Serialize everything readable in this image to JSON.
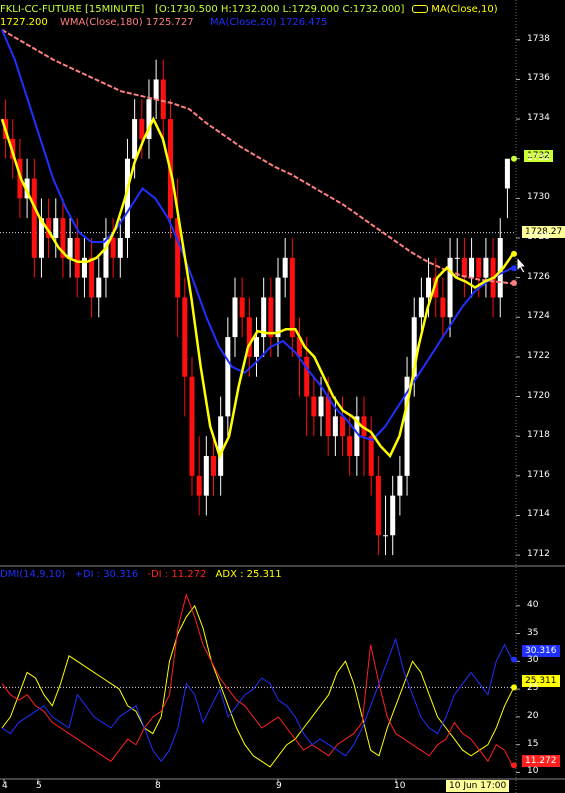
{
  "header": {
    "symbol": "FKLI-CC-FUTURE [15MINUTE]",
    "ohlc": "[O:1730.500 H:1732.000 L:1729.000 C:1732.000]",
    "ma10": "MA(Close,10)",
    "ma10_value": "1727.200",
    "wma180": "WMA(Close,180)",
    "wma180_value": "1725.727",
    "ma20": "MA(Close,20)",
    "ma20_value": "1726.475"
  },
  "dmi_header": {
    "label": "DMI(14,9,10)",
    "pdi": "+DI : 30.316",
    "mdi": "-DI : 11.272",
    "adx": "ADX : 25.311"
  },
  "tags": {
    "last_price": "1732",
    "cursor_price": "1728.27",
    "pdi_value": "30.316",
    "adx_value": "25.311",
    "mdi_value": "11.272",
    "cursor_time": "10 Jun 17:00"
  },
  "colors": {
    "ma10": "#ffff00",
    "wma180": "#ff8080",
    "ma20": "#2030ff",
    "pdi": "#2030ff",
    "mdi": "#ff2020",
    "adx": "#ffff00",
    "bull": "#ffffff",
    "bear": "#ff1010",
    "header_green": "#ccff33"
  },
  "chart_data": [
    {
      "type": "candlestick",
      "title": "FKLI-CC-FUTURE [15MINUTE]",
      "ylim": [
        1711.5,
        1739
      ],
      "yticks": [
        1712,
        1714,
        1716,
        1718,
        1720,
        1722,
        1724,
        1726,
        1728,
        1730,
        1732,
        1734,
        1736,
        1738
      ],
      "close": [
        1733,
        1732,
        1730,
        1731,
        1727,
        1729,
        1728,
        1729,
        1727,
        1728,
        1726,
        1727,
        1725,
        1726,
        1728,
        1727,
        1728,
        1732,
        1734,
        1733,
        1735,
        1736,
        1734,
        1729,
        1725,
        1721,
        1716,
        1715,
        1717,
        1716,
        1719,
        1723,
        1725,
        1724,
        1722,
        1723,
        1725,
        1723,
        1726,
        1727,
        1723,
        1722,
        1720,
        1719,
        1720,
        1718,
        1719,
        1718,
        1717,
        1719,
        1718,
        1716,
        1713,
        1713,
        1715,
        1716,
        1721,
        1724,
        1725,
        1726,
        1725,
        1724,
        1727,
        1727,
        1726,
        1727,
        1726,
        1727,
        1725,
        1728,
        1732
      ],
      "open": [
        1734,
        1733,
        1732,
        1730,
        1731,
        1727,
        1729,
        1728,
        1729,
        1727,
        1728,
        1726,
        1727,
        1725,
        1726,
        1728,
        1727,
        1728,
        1732,
        1734,
        1733,
        1735,
        1736,
        1734,
        1729,
        1725,
        1721,
        1716,
        1715,
        1717,
        1716,
        1719,
        1723,
        1725,
        1724,
        1722,
        1723,
        1725,
        1723,
        1726,
        1727,
        1723,
        1722,
        1720,
        1719,
        1720,
        1718,
        1719,
        1718,
        1717,
        1719,
        1718,
        1716,
        1713,
        1713,
        1715,
        1716,
        1721,
        1724,
        1725,
        1726,
        1725,
        1724,
        1727,
        1727,
        1726,
        1727,
        1726,
        1727,
        1725,
        1730.5
      ],
      "high": [
        1735,
        1734,
        1733,
        1732,
        1732,
        1730,
        1730,
        1730,
        1730,
        1729,
        1729,
        1728,
        1728,
        1727,
        1729,
        1729,
        1729,
        1733,
        1735,
        1735,
        1736,
        1737,
        1737,
        1735,
        1731,
        1726,
        1722,
        1718,
        1718,
        1718,
        1720,
        1724,
        1726,
        1726,
        1725,
        1724,
        1726,
        1726,
        1727,
        1728,
        1728,
        1724,
        1723,
        1721,
        1721,
        1721,
        1720,
        1720,
        1719,
        1720,
        1720,
        1719,
        1717,
        1715,
        1716,
        1717,
        1722,
        1725,
        1726,
        1727,
        1727,
        1726,
        1728,
        1728,
        1728,
        1728,
        1727,
        1728,
        1728,
        1729,
        1732
      ],
      "low": [
        1732,
        1731,
        1729,
        1729,
        1726,
        1726,
        1727,
        1727,
        1726,
        1726,
        1725,
        1725,
        1724,
        1724,
        1725,
        1726,
        1726,
        1727,
        1731,
        1732,
        1732,
        1734,
        1733,
        1728,
        1723,
        1719,
        1715,
        1714,
        1714,
        1715,
        1715,
        1718,
        1722,
        1723,
        1721,
        1721,
        1722,
        1722,
        1722,
        1725,
        1722,
        1720,
        1718,
        1718,
        1718,
        1717,
        1717,
        1717,
        1716,
        1716,
        1716,
        1715,
        1712,
        1712,
        1712,
        1714,
        1715,
        1720,
        1723,
        1724,
        1724,
        1723,
        1723,
        1726,
        1725,
        1725,
        1725,
        1725,
        1724,
        1724,
        1729
      ],
      "series": [
        {
          "name": "MA(Close,10)",
          "values": [
            1734,
            1732.5,
            1731,
            1730,
            1729,
            1728.3,
            1727.5,
            1727,
            1726.8,
            1726.8,
            1727,
            1727.5,
            1728.5,
            1730,
            1731.8,
            1733,
            1734,
            1733,
            1731,
            1728,
            1725,
            1721.5,
            1718.5,
            1717,
            1718,
            1720.5,
            1722.5,
            1723.3,
            1723.2,
            1723.2,
            1723.4,
            1723.4,
            1722.5,
            1722,
            1721,
            1720,
            1719.3,
            1719,
            1718.5,
            1718.2,
            1717.5,
            1717,
            1718,
            1720,
            1722.5,
            1724.5,
            1726,
            1726.5,
            1726,
            1725.8,
            1725.5,
            1725.8,
            1726,
            1726.5,
            1727.2
          ]
        },
        {
          "name": "WMA(Close,180)",
          "values": [
            1738.5,
            1738,
            1737.5,
            1737,
            1736.6,
            1736.2,
            1735.8,
            1735.4,
            1735.2,
            1735,
            1734.8,
            1734.5,
            1733.8,
            1733.2,
            1732.6,
            1732.1,
            1731.6,
            1731.2,
            1730.7,
            1730.2,
            1729.7,
            1729.1,
            1728.5,
            1727.9,
            1727.3,
            1726.8,
            1726.4,
            1726.1,
            1725.9,
            1725.8,
            1725.7
          ]
        },
        {
          "name": "MA(Close,20)",
          "values": [
            1738.5,
            1737,
            1735,
            1733,
            1731,
            1729.5,
            1728.3,
            1727.8,
            1727.8,
            1728.5,
            1729.5,
            1730.5,
            1730,
            1729,
            1727.5,
            1725.8,
            1724,
            1722.5,
            1721.5,
            1721.2,
            1721.8,
            1722.5,
            1722.8,
            1722.2,
            1721.3,
            1720.5,
            1719.5,
            1718.8,
            1718,
            1717.8,
            1718.5,
            1719.5,
            1720.5,
            1721.5,
            1722.5,
            1723.5,
            1724.5,
            1725.3,
            1725.8,
            1726.2,
            1726.5
          ]
        }
      ]
    },
    {
      "type": "line",
      "title": "DMI(14,9,10)",
      "ylim": [
        9,
        45
      ],
      "yticks": [
        10,
        15,
        20,
        25,
        30,
        35,
        40
      ],
      "series": [
        {
          "name": "+DI",
          "values": [
            18,
            17,
            19,
            20,
            21,
            22,
            20,
            19,
            18,
            24,
            22,
            20,
            19,
            18,
            20,
            21,
            22,
            18,
            14,
            12,
            14,
            18,
            26,
            24,
            19,
            22,
            25,
            20,
            22,
            24,
            25,
            27,
            26,
            23,
            22,
            20,
            17,
            15,
            16,
            15,
            14,
            13,
            15,
            18,
            22,
            26,
            30,
            34,
            28,
            24,
            20,
            18,
            17,
            20,
            24,
            26,
            28,
            26,
            24,
            30,
            33,
            30
          ]
        },
        {
          "name": "-DI",
          "values": [
            26,
            24,
            23,
            24,
            22,
            21,
            19,
            18,
            17,
            16,
            15,
            14,
            13,
            12,
            14,
            16,
            15,
            18,
            20,
            21,
            24,
            36,
            42,
            38,
            33,
            30,
            27,
            25,
            23,
            22,
            20,
            18,
            19,
            20,
            18,
            16,
            14,
            15,
            14,
            13,
            15,
            16,
            17,
            19,
            33,
            26,
            20,
            17,
            16,
            15,
            14,
            13,
            15,
            16,
            19,
            17,
            16,
            14,
            12,
            15,
            14,
            11
          ]
        },
        {
          "name": "ADX",
          "values": [
            18,
            20,
            24,
            28,
            27,
            24,
            22,
            26,
            31,
            30,
            29,
            28,
            27,
            26,
            25,
            22,
            21,
            18,
            17,
            20,
            30,
            35,
            38,
            40,
            36,
            30,
            26,
            22,
            18,
            15,
            13,
            12,
            11,
            13,
            15,
            16,
            18,
            20,
            22,
            24,
            28,
            30,
            26,
            20,
            14,
            13,
            18,
            22,
            26,
            30,
            28,
            24,
            20,
            18,
            16,
            14,
            13,
            14,
            15,
            18,
            22,
            25
          ]
        }
      ]
    }
  ]
}
